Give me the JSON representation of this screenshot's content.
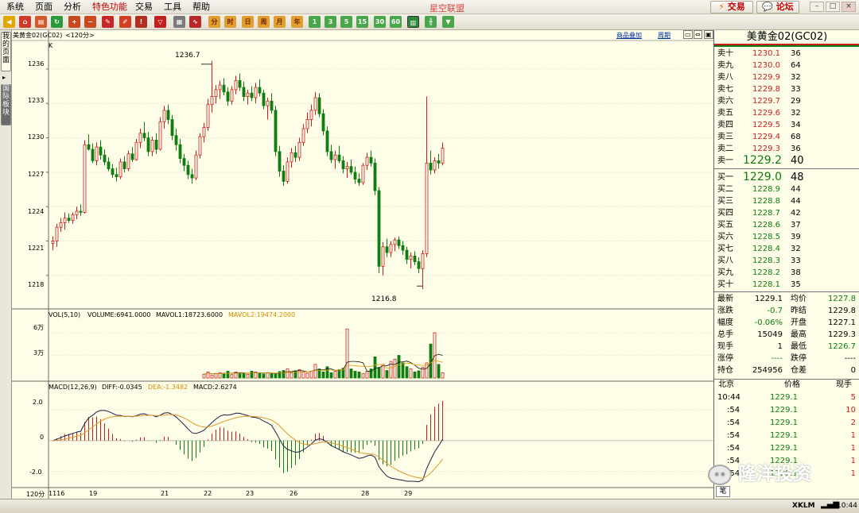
{
  "menu": [
    "系统",
    "页面",
    "分析",
    "特色功能",
    "交易",
    "工具",
    "帮助"
  ],
  "app_title": "星空联盟",
  "top_buttons": {
    "trade": "交易",
    "forum": "论坛"
  },
  "window_controls": [
    "–",
    "□",
    "×"
  ],
  "toolbar_periods": [
    "分",
    "时",
    "日",
    "周",
    "月",
    "年",
    "1",
    "3",
    "5",
    "15",
    "30",
    "60"
  ],
  "sidebar_tabs": [
    "我的页面",
    "国际板块"
  ],
  "chart": {
    "title": "美黄金02(GC02)",
    "period": "<120分>",
    "overlay_link": "商品叠加",
    "period_link": "周期",
    "k_label": "K",
    "y_ticks": [
      "1236",
      "1233",
      "1230",
      "1227",
      "1224",
      "1221",
      "1218"
    ],
    "high_label": "1236.7",
    "low_label": "1216.8",
    "vol_legend": {
      "vol": "VOL(5,10)",
      "volume": "VOLUME:6941.0000",
      "mavol1": "MAVOL1:18723.6000",
      "mavol2": "MAVOL2:19474.2000"
    },
    "vol_ticks": [
      "6万",
      "3万"
    ],
    "macd_legend": {
      "macd_params": "MACD(12,26,9)",
      "diff": "DIFF:-0.0345",
      "dea": "DEA:-1.3482",
      "macd": "MACD:2.6274"
    },
    "macd_ticks": [
      "2.0",
      "0",
      "-2.0"
    ],
    "period_corner": "120分",
    "x_labels": [
      "1116",
      "19",
      "21",
      "22",
      "23",
      "26",
      "28",
      "29"
    ]
  },
  "chart_data": {
    "type": "candlestick",
    "title": "美黄金02(GC02)",
    "ylim": [
      1215.5,
      1238
    ],
    "candles": [
      [
        1220.8,
        1221.4,
        1220.2,
        1221.0
      ],
      [
        1221.0,
        1222.5,
        1220.5,
        1222.2
      ],
      [
        1222.2,
        1223.0,
        1221.8,
        1222.6
      ],
      [
        1222.6,
        1223.5,
        1222.0,
        1223.0
      ],
      [
        1223.0,
        1223.4,
        1222.6,
        1222.8
      ],
      [
        1222.8,
        1223.5,
        1222.5,
        1223.3
      ],
      [
        1223.3,
        1224.0,
        1222.9,
        1223.6
      ],
      [
        1223.6,
        1224.2,
        1223.2,
        1223.5
      ],
      [
        1223.5,
        1229.8,
        1223.4,
        1229.4
      ],
      [
        1229.4,
        1230.3,
        1228.9,
        1229.0
      ],
      [
        1229.0,
        1229.5,
        1227.8,
        1228.0
      ],
      [
        1228.0,
        1229.6,
        1227.6,
        1229.2
      ],
      [
        1229.2,
        1229.8,
        1228.1,
        1228.5
      ],
      [
        1228.5,
        1229.0,
        1227.6,
        1227.9
      ],
      [
        1227.9,
        1228.3,
        1227.1,
        1227.3
      ],
      [
        1227.3,
        1227.7,
        1226.5,
        1226.8
      ],
      [
        1226.8,
        1227.4,
        1226.2,
        1226.6
      ],
      [
        1226.6,
        1228.2,
        1226.4,
        1227.9
      ],
      [
        1227.9,
        1228.4,
        1227.0,
        1227.3
      ],
      [
        1227.3,
        1228.9,
        1227.1,
        1228.6
      ],
      [
        1228.6,
        1229.2,
        1227.9,
        1228.1
      ],
      [
        1228.1,
        1229.9,
        1228.0,
        1229.6
      ],
      [
        1229.6,
        1230.8,
        1229.1,
        1230.4
      ],
      [
        1230.4,
        1231.4,
        1229.7,
        1230.0
      ],
      [
        1230.0,
        1230.5,
        1228.4,
        1228.8
      ],
      [
        1228.8,
        1230.1,
        1228.4,
        1229.8
      ],
      [
        1229.8,
        1230.4,
        1228.6,
        1229.0
      ],
      [
        1229.0,
        1231.8,
        1228.9,
        1231.4
      ],
      [
        1231.4,
        1232.8,
        1230.8,
        1232.4
      ],
      [
        1232.4,
        1232.9,
        1231.2,
        1231.6
      ],
      [
        1231.6,
        1232.0,
        1229.8,
        1230.2
      ],
      [
        1230.2,
        1230.8,
        1228.9,
        1229.4
      ],
      [
        1229.4,
        1229.9,
        1227.8,
        1228.2
      ],
      [
        1228.2,
        1228.6,
        1227.1,
        1227.6
      ],
      [
        1227.6,
        1228.0,
        1226.4,
        1226.8
      ],
      [
        1226.8,
        1227.3,
        1226.0,
        1226.5
      ],
      [
        1226.5,
        1228.9,
        1226.3,
        1228.5
      ],
      [
        1228.5,
        1230.4,
        1228.2,
        1230.1
      ],
      [
        1230.1,
        1231.3,
        1229.6,
        1230.9
      ],
      [
        1230.9,
        1233.4,
        1230.6,
        1232.9
      ],
      [
        1232.9,
        1236.7,
        1232.2,
        1233.6
      ],
      [
        1233.6,
        1234.6,
        1233.0,
        1234.2
      ],
      [
        1234.2,
        1235.0,
        1233.4,
        1234.6
      ],
      [
        1234.6,
        1235.2,
        1233.7,
        1234.0
      ],
      [
        1234.0,
        1234.4,
        1232.8,
        1233.2
      ],
      [
        1233.2,
        1234.5,
        1232.9,
        1234.2
      ],
      [
        1234.2,
        1235.4,
        1233.8,
        1235.0
      ],
      [
        1235.0,
        1235.6,
        1234.1,
        1234.4
      ],
      [
        1234.4,
        1234.9,
        1233.2,
        1233.6
      ],
      [
        1233.6,
        1234.2,
        1232.9,
        1233.9
      ],
      [
        1233.9,
        1234.5,
        1233.2,
        1233.5
      ],
      [
        1233.5,
        1234.8,
        1233.0,
        1234.4
      ],
      [
        1234.4,
        1235.1,
        1233.6,
        1233.9
      ],
      [
        1233.9,
        1234.2,
        1232.5,
        1232.8
      ],
      [
        1232.8,
        1233.5,
        1231.6,
        1233.2
      ],
      [
        1233.2,
        1233.9,
        1232.1,
        1232.4
      ],
      [
        1232.4,
        1232.8,
        1228.4,
        1228.8
      ],
      [
        1228.8,
        1229.3,
        1226.6,
        1227.1
      ],
      [
        1227.1,
        1227.6,
        1225.8,
        1226.2
      ],
      [
        1226.2,
        1228.3,
        1226.0,
        1227.9
      ],
      [
        1227.9,
        1229.1,
        1227.4,
        1228.7
      ],
      [
        1228.7,
        1229.3,
        1227.9,
        1228.3
      ],
      [
        1228.3,
        1230.0,
        1228.0,
        1229.6
      ],
      [
        1229.6,
        1231.2,
        1229.3,
        1230.8
      ],
      [
        1230.8,
        1232.2,
        1230.4,
        1231.6
      ],
      [
        1231.6,
        1232.9,
        1231.0,
        1232.4
      ],
      [
        1232.4,
        1234.0,
        1232.0,
        1233.5
      ],
      [
        1233.5,
        1233.9,
        1231.8,
        1232.1
      ],
      [
        1232.1,
        1232.5,
        1230.2,
        1230.6
      ],
      [
        1230.6,
        1231.0,
        1228.4,
        1228.8
      ],
      [
        1228.8,
        1229.4,
        1227.8,
        1228.1
      ],
      [
        1228.1,
        1228.9,
        1227.3,
        1228.5
      ],
      [
        1228.5,
        1229.3,
        1227.8,
        1228.0
      ],
      [
        1228.0,
        1228.4,
        1226.9,
        1227.3
      ],
      [
        1227.3,
        1227.9,
        1226.5,
        1227.5
      ],
      [
        1227.5,
        1228.1,
        1226.8,
        1227.0
      ],
      [
        1227.0,
        1227.5,
        1226.0,
        1226.4
      ],
      [
        1226.4,
        1226.9,
        1225.8,
        1226.1
      ],
      [
        1226.1,
        1227.8,
        1225.9,
        1227.6
      ],
      [
        1227.6,
        1228.7,
        1227.2,
        1228.3
      ],
      [
        1228.3,
        1228.9,
        1227.5,
        1227.8
      ],
      [
        1227.8,
        1228.2,
        1225.0,
        1225.4
      ],
      [
        1225.4,
        1225.7,
        1218.2,
        1218.8
      ],
      [
        1218.8,
        1220.9,
        1218.0,
        1220.5
      ],
      [
        1220.5,
        1221.2,
        1219.6,
        1220.0
      ],
      [
        1220.0,
        1221.0,
        1219.6,
        1220.7
      ],
      [
        1220.7,
        1221.3,
        1220.1,
        1221.1
      ],
      [
        1221.1,
        1221.4,
        1220.3,
        1220.6
      ],
      [
        1220.6,
        1221.0,
        1219.8,
        1220.2
      ],
      [
        1220.2,
        1220.5,
        1219.0,
        1219.4
      ],
      [
        1219.4,
        1220.0,
        1218.6,
        1219.7
      ],
      [
        1219.7,
        1220.1,
        1218.9,
        1219.2
      ],
      [
        1219.2,
        1219.6,
        1218.2,
        1218.6
      ],
      [
        1218.6,
        1220.2,
        1216.8,
        1219.9
      ],
      [
        1219.9,
        1233.6,
        1219.6,
        1227.8
      ],
      [
        1227.8,
        1228.9,
        1226.8,
        1227.2
      ],
      [
        1227.2,
        1228.3,
        1226.9,
        1228.0
      ],
      [
        1228.0,
        1228.6,
        1227.3,
        1227.8
      ],
      [
        1227.8,
        1229.6,
        1227.6,
        1229.1
      ]
    ],
    "x_labels": [
      "1116",
      "19",
      "21",
      "22",
      "23",
      "26",
      "28",
      "29"
    ],
    "y_ticks": [
      1236,
      1233,
      1230,
      1227,
      1224,
      1221,
      1218
    ],
    "volume": {
      "ylim": [
        0,
        80000
      ],
      "ticks": [
        60000,
        30000
      ],
      "last_bars": [
        [
          5000,
          8000,
          4000,
          6000,
          7000,
          5500,
          9000,
          4500,
          8000,
          7000,
          6500,
          5000,
          9000,
          8000,
          6000,
          5500,
          7000,
          6000,
          5000,
          8500
        ],
        [
          10000,
          12000,
          7000,
          9500,
          11000,
          8000,
          6500,
          9000,
          18000,
          12000,
          8000,
          15000,
          7000,
          9000,
          11000,
          13000,
          65000,
          12000,
          9000,
          8000
        ],
        [
          6000,
          9000,
          12000,
          28000,
          14000,
          18000,
          10000,
          22000,
          25000,
          30000,
          20000,
          15000,
          12000,
          8000,
          9500,
          14000,
          20000,
          45000,
          60000,
          18000,
          6941
        ]
      ],
      "mavol1_last": 18723.6,
      "mavol2_last": 19474.2
    },
    "macd": {
      "ylim": [
        -3.0,
        3.2
      ],
      "ticks": [
        2.0,
        0,
        -2.0
      ],
      "diff_last": -0.0345,
      "dea_last": -1.3482,
      "macd_last": 2.6274
    }
  },
  "orderbook": {
    "name": "美黄金02(GC02)",
    "asks": [
      {
        "label": "卖十",
        "price": "1230.1",
        "vol": "36"
      },
      {
        "label": "卖九",
        "price": "1230.0",
        "vol": "64"
      },
      {
        "label": "卖八",
        "price": "1229.9",
        "vol": "32"
      },
      {
        "label": "卖七",
        "price": "1229.8",
        "vol": "33"
      },
      {
        "label": "卖六",
        "price": "1229.7",
        "vol": "29"
      },
      {
        "label": "卖五",
        "price": "1229.6",
        "vol": "32"
      },
      {
        "label": "卖四",
        "price": "1229.5",
        "vol": "34"
      },
      {
        "label": "卖三",
        "price": "1229.4",
        "vol": "68"
      },
      {
        "label": "卖二",
        "price": "1229.3",
        "vol": "36"
      },
      {
        "label": "卖一",
        "price": "1229.2",
        "vol": "40"
      }
    ],
    "bids": [
      {
        "label": "买一",
        "price": "1229.0",
        "vol": "48"
      },
      {
        "label": "买二",
        "price": "1228.9",
        "vol": "44"
      },
      {
        "label": "买三",
        "price": "1228.8",
        "vol": "44"
      },
      {
        "label": "买四",
        "price": "1228.7",
        "vol": "42"
      },
      {
        "label": "买五",
        "price": "1228.6",
        "vol": "37"
      },
      {
        "label": "买六",
        "price": "1228.5",
        "vol": "39"
      },
      {
        "label": "买七",
        "price": "1228.4",
        "vol": "32"
      },
      {
        "label": "买八",
        "price": "1228.3",
        "vol": "33"
      },
      {
        "label": "买九",
        "price": "1228.2",
        "vol": "38"
      },
      {
        "label": "买十",
        "price": "1228.1",
        "vol": "35"
      }
    ]
  },
  "stats": [
    {
      "l1": "最新",
      "v1": "1229.1",
      "l2": "均价",
      "v2": "1227.8"
    },
    {
      "l1": "涨跌",
      "v1": "-0.7",
      "l2": "昨结",
      "v2": "1229.8"
    },
    {
      "l1": "幅度",
      "v1": "-0.06%",
      "l2": "开盘",
      "v2": "1227.1"
    },
    {
      "l1": "总手",
      "v1": "15049",
      "l2": "最高",
      "v2": "1229.3"
    },
    {
      "l1": "现手",
      "v1": "1",
      "l2": "最低",
      "v2": "1226.7"
    },
    {
      "l1": "涨停",
      "v1": "----",
      "l2": "跌停",
      "v2": "----"
    },
    {
      "l1": "持仓",
      "v1": "254956",
      "l2": "仓差",
      "v2": "0"
    }
  ],
  "ticks": {
    "headers": {
      "time": "北京",
      "price": "价格",
      "volume": "现手"
    },
    "rows": [
      {
        "time": "10:44",
        "price": "1229.1",
        "volume": "5"
      },
      {
        "time": ":54",
        "price": "1229.1",
        "volume": "10"
      },
      {
        "time": ":54",
        "price": "1229.1",
        "volume": "2"
      },
      {
        "time": ":54",
        "price": "1229.1",
        "volume": "1"
      },
      {
        "time": ":54",
        "price": "1229.1",
        "volume": "1"
      },
      {
        "time": ":54",
        "price": "1229.1",
        "volume": "1"
      },
      {
        "time": ":54",
        "price": "1229.1",
        "volume": "1"
      }
    ],
    "tab": "笔"
  },
  "watermark": "隆洋投资",
  "status": {
    "xklm": "XKLM",
    "time": "10:44"
  },
  "colors": {
    "up": "#c81e1e",
    "down": "#0f7d0f",
    "macd_diff": "#20204a",
    "macd_dea": "#e09a2a",
    "vol_ma1": "#111111",
    "vol_ma2": "#e2a200"
  }
}
